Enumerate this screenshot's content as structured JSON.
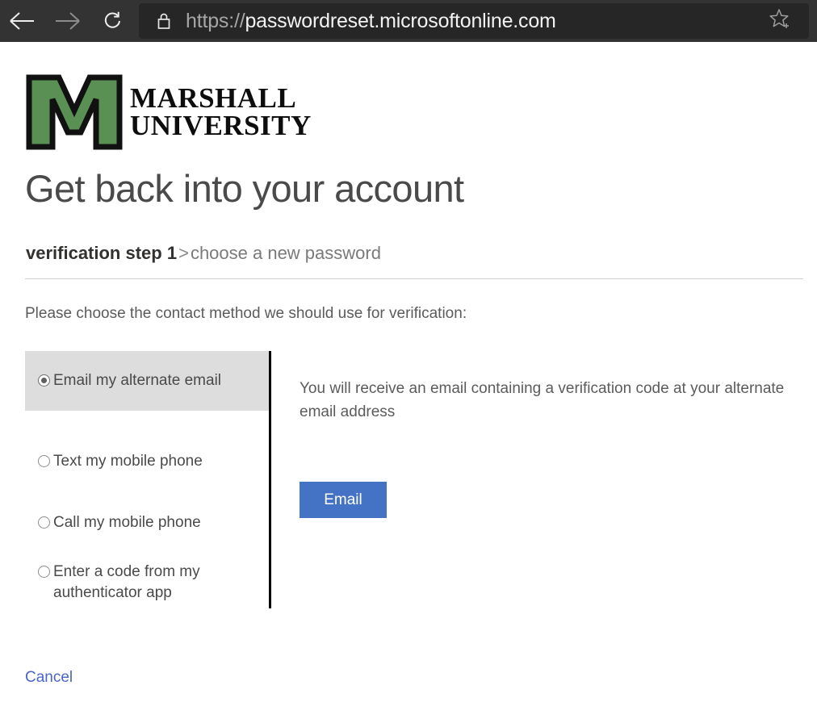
{
  "browser": {
    "back_icon": "back-arrow-icon",
    "forward_icon": "forward-arrow-icon",
    "reload_icon": "reload-icon",
    "lock_icon": "padlock-icon",
    "favorite_icon": "add-favorite-star-icon",
    "url_scheme": "https://",
    "url_host": "passwordreset.microsoftonline.com",
    "url_full": "https://passwordreset.microsoftonline.com"
  },
  "branding": {
    "logo_mark": "marshall-m-logo",
    "name_line1": "MARSHALL",
    "name_line2": "UNIVERSITY",
    "green": "#5b9055",
    "outline": "#111111"
  },
  "page": {
    "title": "Get back into your account",
    "steps": {
      "current": "verification step 1",
      "separator": ">",
      "next": "choose a new password"
    },
    "lead": "Please choose the contact method we should use for verification:"
  },
  "options": {
    "selected_index": 0,
    "items": [
      {
        "label": "Email my alternate email",
        "selected": true
      },
      {
        "label": "Text my mobile phone",
        "selected": false
      },
      {
        "label": "Call my mobile phone",
        "selected": false
      },
      {
        "label": "Enter a code from my authenticator app",
        "selected": false
      }
    ]
  },
  "detail": {
    "description": "You will receive an email containing a verification code at your alternate email address",
    "action_label": "Email",
    "action_color": "#4472c4"
  },
  "footer": {
    "cancel_label": "Cancel",
    "link_color": "#4a66c4"
  }
}
